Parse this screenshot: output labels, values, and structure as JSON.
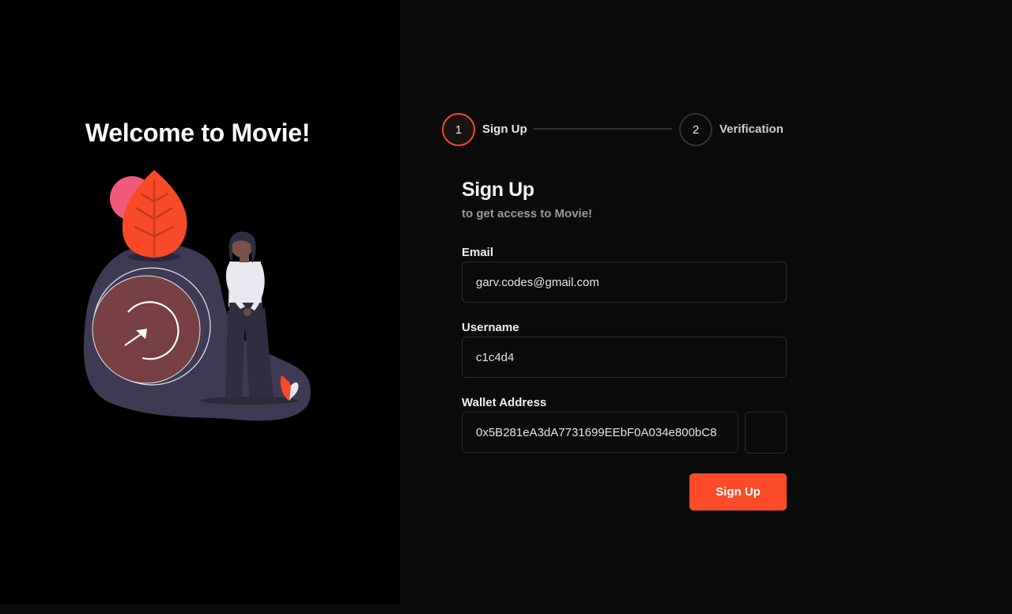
{
  "welcome": {
    "title": "Welcome to Movie!"
  },
  "stepper": {
    "steps": [
      {
        "number": "1",
        "label": "Sign Up",
        "state": "active"
      },
      {
        "number": "2",
        "label": "Verification",
        "state": "inactive"
      }
    ]
  },
  "form": {
    "title": "Sign Up",
    "subtitle": "to get access to Movie!",
    "email": {
      "label": "Email",
      "value": "garv.codes@gmail.com"
    },
    "username": {
      "label": "Username",
      "value": "c1c4d4"
    },
    "wallet": {
      "label": "Wallet Address",
      "value": "0x5B281eA3dA7731699EEbF0A034e800bC8"
    },
    "submit_label": "Sign Up"
  },
  "colors": {
    "accent": "#fb4b29",
    "left_background": "#000000",
    "right_background": "#0b0b0b"
  }
}
